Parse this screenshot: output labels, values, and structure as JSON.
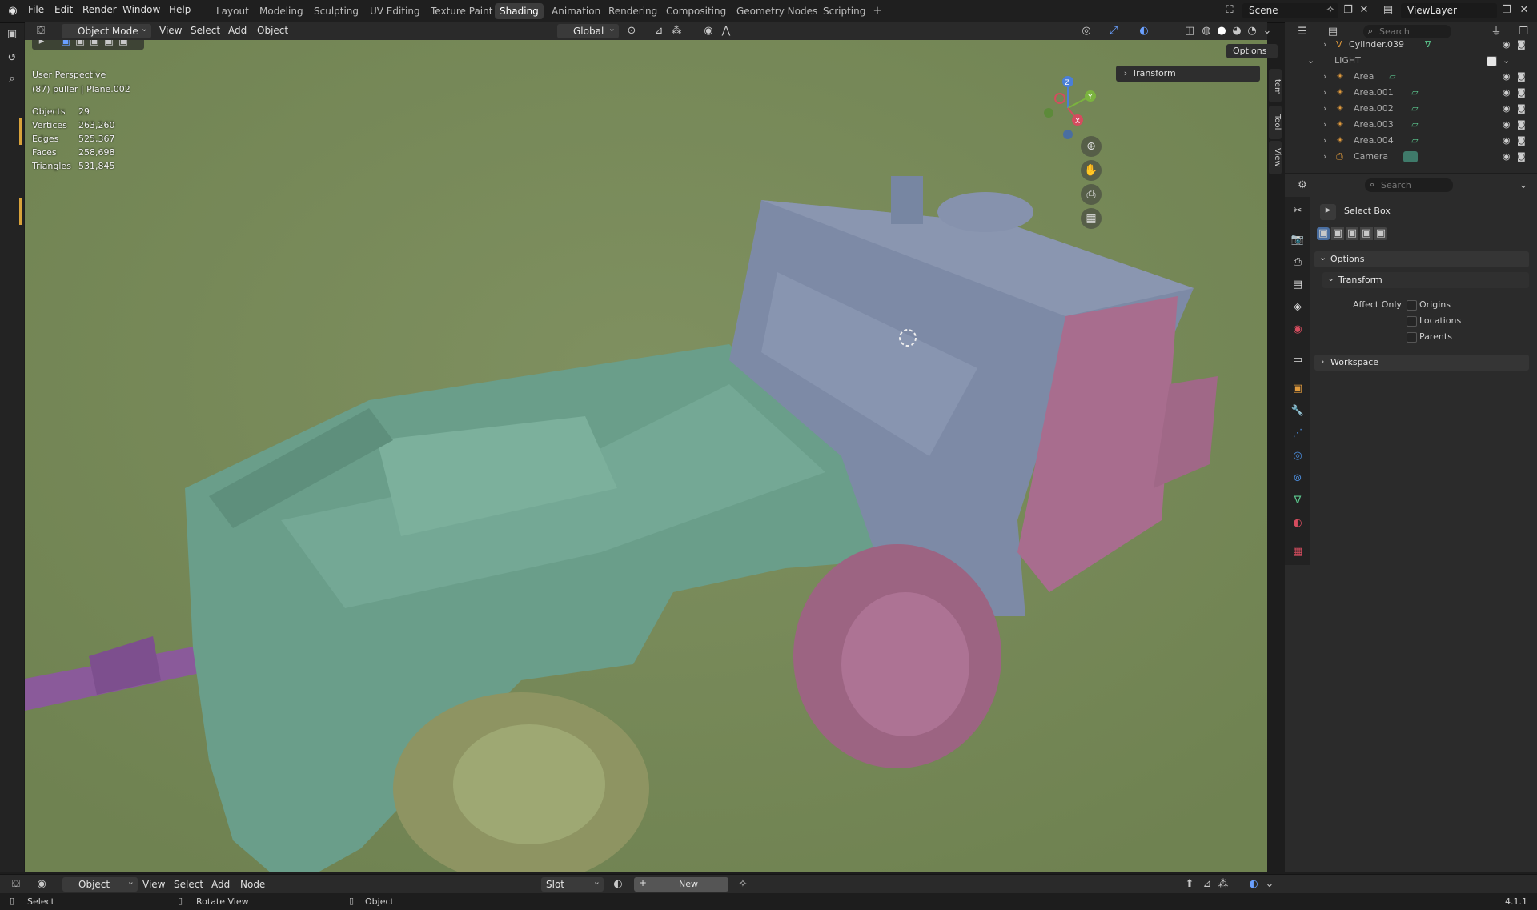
{
  "menu": [
    "File",
    "Edit",
    "Render",
    "Window",
    "Help"
  ],
  "workspaces": [
    "Layout",
    "Modeling",
    "Sculpting",
    "UV Editing",
    "Texture Paint",
    "Shading",
    "Animation",
    "Rendering",
    "Compositing",
    "Geometry Nodes",
    "Scripting"
  ],
  "active_workspace": "Shading",
  "scene": {
    "label": "Scene"
  },
  "view_layer": {
    "label": "ViewLayer"
  },
  "viewport_header": {
    "mode": "Object Mode",
    "items": [
      "View",
      "Select",
      "Add",
      "Object"
    ],
    "transform_orientation": "Global",
    "options_label": "Options"
  },
  "viewport_overlay": {
    "perspective": "User Perspective",
    "active": "(87) puller | Plane.002",
    "stats": [
      {
        "label": "Objects",
        "value": "29"
      },
      {
        "label": "Vertices",
        "value": "263,260"
      },
      {
        "label": "Edges",
        "value": "525,367"
      },
      {
        "label": "Faces",
        "value": "258,698"
      },
      {
        "label": "Triangles",
        "value": "531,845"
      }
    ]
  },
  "n_panel": {
    "transform_label": "Transform",
    "tabs": [
      "Item",
      "Tool",
      "View"
    ]
  },
  "gizmo": {
    "x": "X",
    "y": "Y",
    "z": "Z"
  },
  "outliner": {
    "search_placeholder": "Search",
    "rows": [
      {
        "name": "Cylinder.039",
        "type": "mesh"
      },
      {
        "name": "LIGHT",
        "type": "collection"
      },
      {
        "name": "Area",
        "type": "light"
      },
      {
        "name": "Area.001",
        "type": "light"
      },
      {
        "name": "Area.002",
        "type": "light"
      },
      {
        "name": "Area.003",
        "type": "light"
      },
      {
        "name": "Area.004",
        "type": "light"
      },
      {
        "name": "Camera",
        "type": "camera"
      }
    ]
  },
  "properties": {
    "search_placeholder": "Search",
    "tool_name": "Select Box",
    "options_label": "Options",
    "transform_label": "Transform",
    "affect_only_label": "Affect Only",
    "checks": [
      "Origins",
      "Locations",
      "Parents"
    ],
    "workspace_label": "Workspace"
  },
  "shader_editor_header": {
    "mode": "Object",
    "items": [
      "View",
      "Select",
      "Add",
      "Node"
    ],
    "slot": "Slot",
    "new_label": "New"
  },
  "statusbar": {
    "select": "Select",
    "rotate": "Rotate View",
    "object": "Object",
    "version": "4.1.1"
  }
}
